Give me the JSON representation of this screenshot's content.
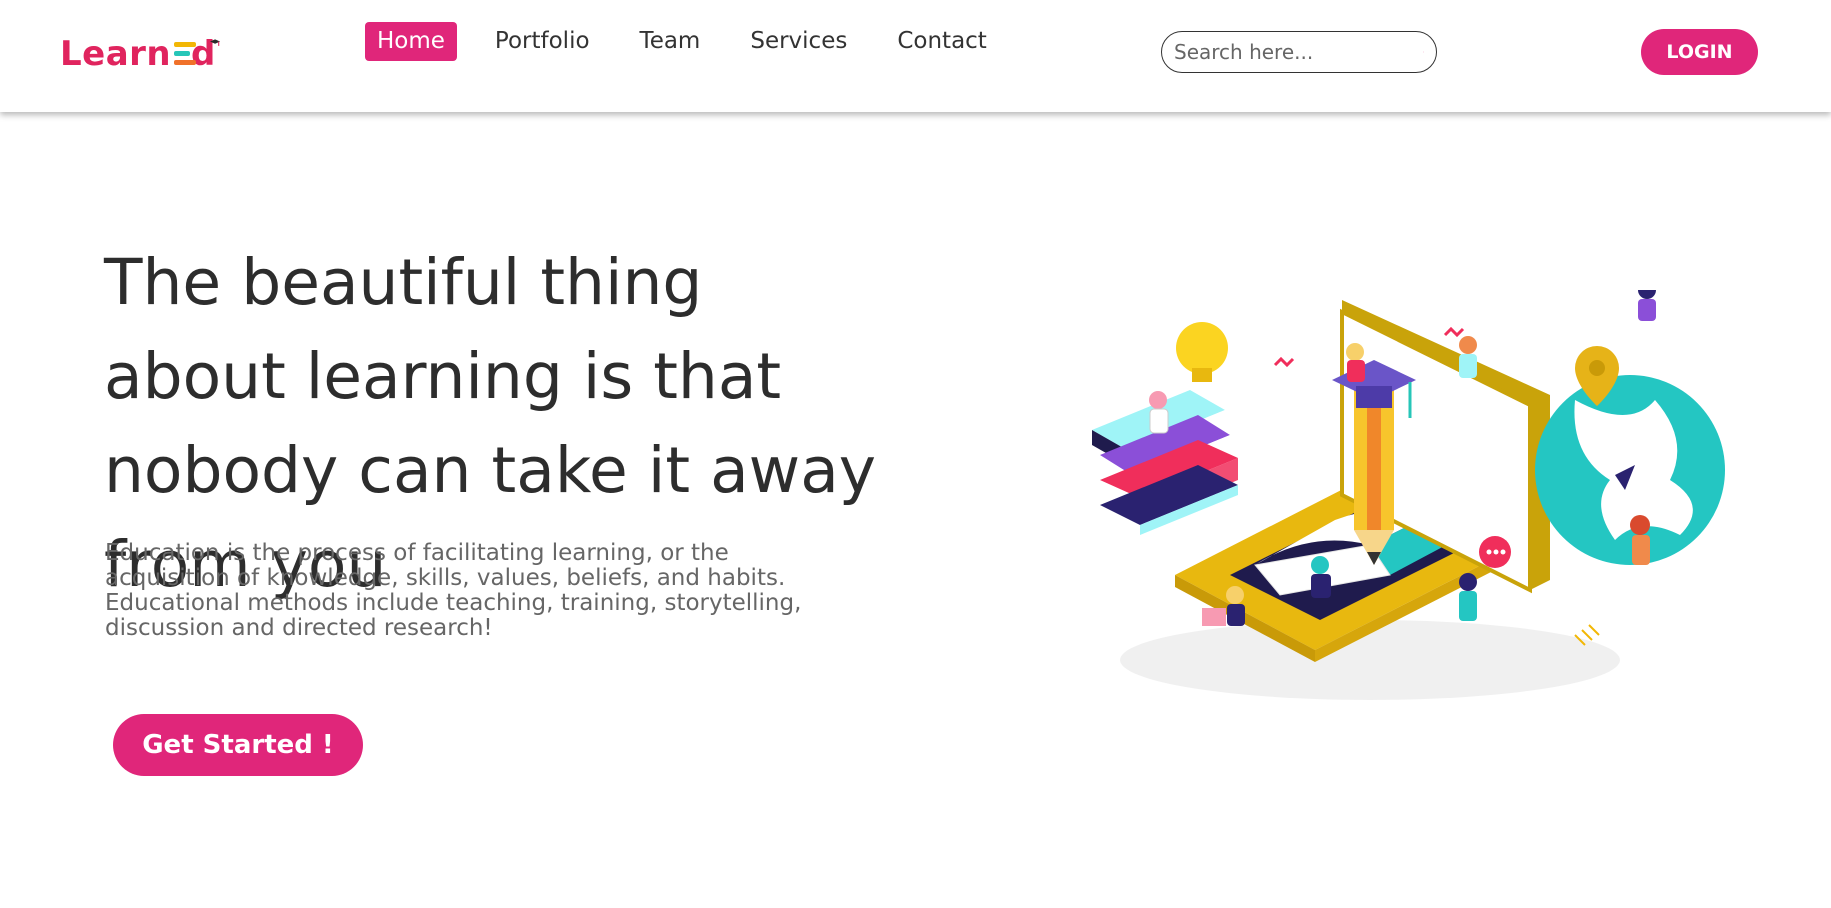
{
  "brand": {
    "logo_prefix": "Learn",
    "logo_suffix": "d",
    "colors": {
      "primary": "#e0267a",
      "logo": "#e0245e"
    }
  },
  "nav": {
    "items": [
      {
        "label": "Home",
        "active": true
      },
      {
        "label": "Portfolio",
        "active": false
      },
      {
        "label": "Team",
        "active": false
      },
      {
        "label": "Services",
        "active": false
      },
      {
        "label": "Contact",
        "active": false
      }
    ]
  },
  "search": {
    "placeholder": "Search here...",
    "value": "",
    "icon": "search-icon"
  },
  "header": {
    "login_label": "LOGIN"
  },
  "hero": {
    "title": "The beautiful thing about learning is that nobody can take it away from you",
    "description": "Education is the process of facilitating learning, or the acquisition of knowledge, skills, values, beliefs, and habits. Educational methods include teaching, training, storytelling, discussion and directed research!",
    "cta_label": "Get Started !"
  }
}
